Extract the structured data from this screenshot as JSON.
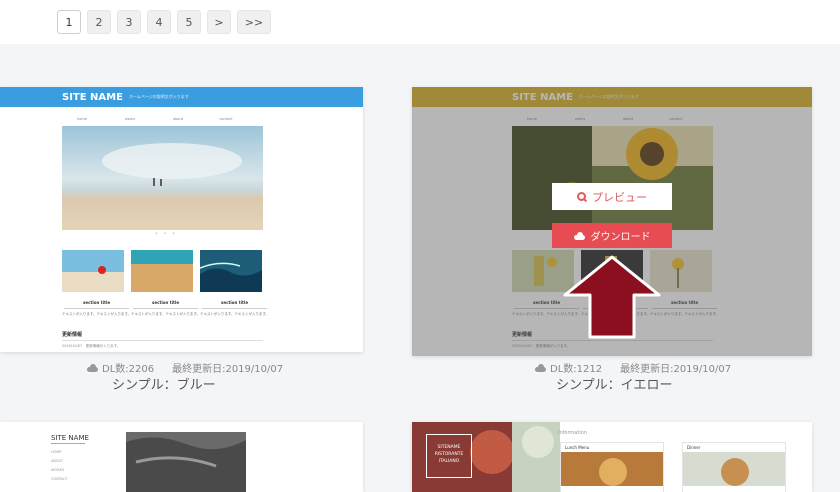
{
  "pagination": {
    "pages": [
      "1",
      "2",
      "3",
      "4",
      "5"
    ],
    "next": ">",
    "last": ">>"
  },
  "cards": [
    {
      "preview": {
        "site_name": "SITE NAME",
        "tagline": "ホームページの説明文が入ります",
        "nav": [
          "home",
          "works",
          "about",
          "contact"
        ],
        "sections": [
          {
            "title": "section title",
            "desc": "テキストが入ります。テキストが入ります。"
          },
          {
            "title": "section title",
            "desc": "テキストが入ります。テキストが入ります。"
          },
          {
            "title": "section title",
            "desc": "テキストが入ります。テキストが入ります。"
          }
        ],
        "news_title": "更新情報",
        "news_row": "2019/10/07　更新情報が入ります。"
      },
      "dl_count": "DL数:2206",
      "updated": "最終更新日:2019/10/07",
      "title": "シンプル：ブルー"
    },
    {
      "preview": {
        "site_name": "SITE NAME",
        "tagline": "ホームページの説明文が入ります",
        "nav": [
          "home",
          "works",
          "about",
          "contact"
        ],
        "sections": [
          {
            "title": "section title",
            "desc": "テキストが入ります。テキストが入ります。"
          },
          {
            "title": "section title",
            "desc": "テキストが入ります。テキストが入ります。"
          },
          {
            "title": "section title",
            "desc": "テキストが入ります。テキストが入ります。"
          }
        ],
        "news_title": "更新情報",
        "news_row": "2019/10/07　更新情報が入ります。"
      },
      "preview_button": "プレビュー",
      "download_button": "ダウンロード",
      "dl_count": "DL数:1212",
      "updated": "最終更新日:2019/10/07",
      "title": "シンプル：イエロー"
    },
    {
      "preview": {
        "site_name": "SITE NAME",
        "side": [
          "HOME",
          "ABOUT",
          "WORKS",
          "CONTACT"
        ]
      }
    },
    {
      "preview": {
        "logo": "SITENAME\nRISTORANTE\nITALIANO",
        "info": "Information",
        "items": [
          "Lunch Menu",
          "Dinner"
        ]
      }
    }
  ],
  "colors": {
    "blue_header": "#3a9de0",
    "yellow_header": "#d9b32a",
    "download_red": "#e64c52",
    "arrow_fill": "#8b0f1e"
  }
}
